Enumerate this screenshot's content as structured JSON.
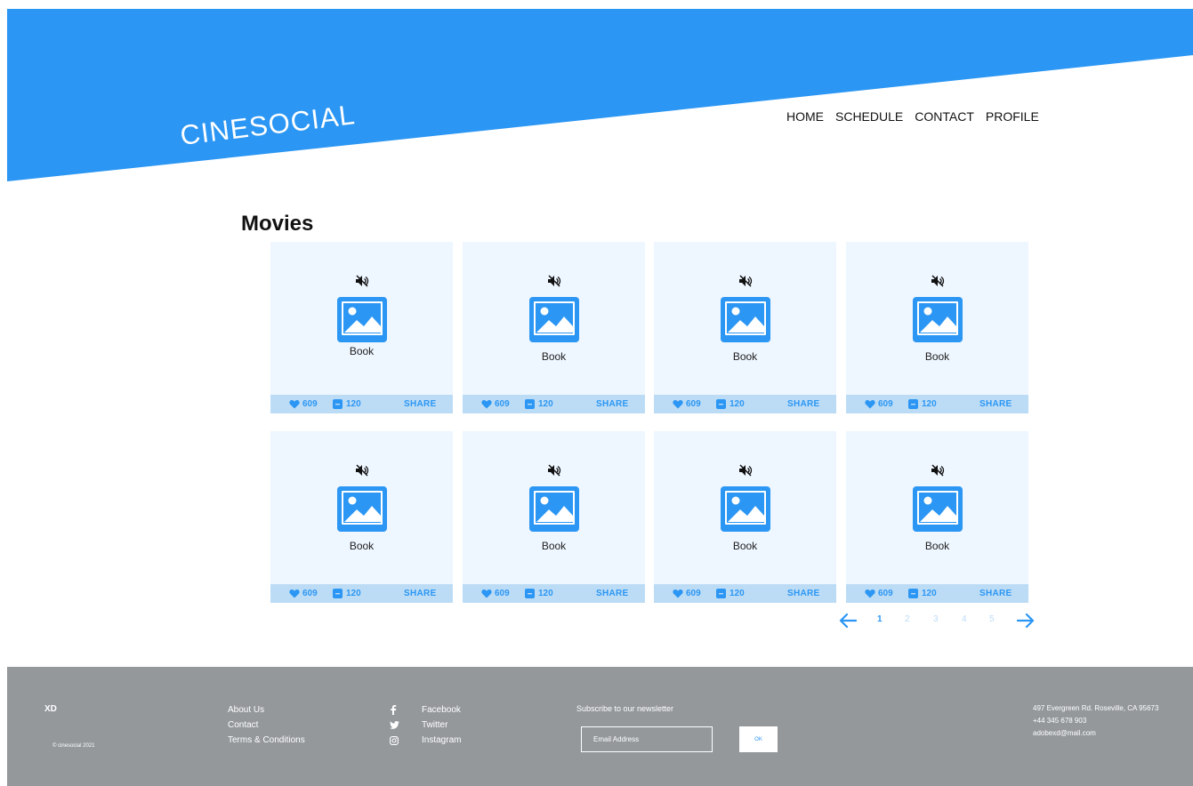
{
  "colors": {
    "accent": "#2b96f3",
    "card_bg": "#eef6ff",
    "card_bar": "#bcdcf6",
    "footer_bg": "#94989b"
  },
  "header": {
    "brand": "CINESOCIAL",
    "nav": [
      "HOME",
      "SCHEDULE",
      "CONTACT",
      "PROFILE"
    ]
  },
  "main": {
    "title": "Movies",
    "cards": [
      {
        "icon_mute": "mute-icon",
        "icon_image": "image-placeholder-icon",
        "label": "Book",
        "likes": "609",
        "comments": "120",
        "share": "SHARE"
      },
      {
        "icon_mute": "mute-icon",
        "icon_image": "image-placeholder-icon",
        "label": "Book",
        "likes": "609",
        "comments": "120",
        "share": "SHARE"
      },
      {
        "icon_mute": "mute-icon",
        "icon_image": "image-placeholder-icon",
        "label": "Book",
        "likes": "609",
        "comments": "120",
        "share": "SHARE"
      },
      {
        "icon_mute": "mute-icon",
        "icon_image": "image-placeholder-icon",
        "label": "Book",
        "likes": "609",
        "comments": "120",
        "share": "SHARE"
      },
      {
        "icon_mute": "mute-icon",
        "icon_image": "image-placeholder-icon",
        "label": "Book",
        "likes": "609",
        "comments": "120",
        "share": "SHARE"
      },
      {
        "icon_mute": "mute-icon",
        "icon_image": "image-placeholder-icon",
        "label": "Book",
        "likes": "609",
        "comments": "120",
        "share": "SHARE"
      },
      {
        "icon_mute": "mute-icon",
        "icon_image": "image-placeholder-icon",
        "label": "Book",
        "likes": "609",
        "comments": "120",
        "share": "SHARE"
      },
      {
        "icon_mute": "mute-icon",
        "icon_image": "image-placeholder-icon",
        "label": "Book",
        "likes": "609",
        "comments": "120",
        "share": "SHARE"
      }
    ],
    "pagination": {
      "pages": [
        "1",
        "2",
        "3",
        "4",
        "5"
      ],
      "current": "1"
    }
  },
  "footer": {
    "logo": "XD",
    "copyright": "© cinesocial 2021",
    "links": [
      "About Us",
      "Contact",
      "Terms & Conditions"
    ],
    "social": [
      {
        "icon": "facebook-icon",
        "label": "Facebook"
      },
      {
        "icon": "twitter-icon",
        "label": "Twitter"
      },
      {
        "icon": "instagram-icon",
        "label": "Instagram"
      }
    ],
    "newsletter_title": "Subscribe to our newsletter",
    "email_placeholder": "Email Address",
    "ok_label": "OK",
    "address": "497 Evergreen Rd. Roseville, CA 95673",
    "phone": "+44 345 678 903",
    "email": "adobexd@mail.com"
  }
}
